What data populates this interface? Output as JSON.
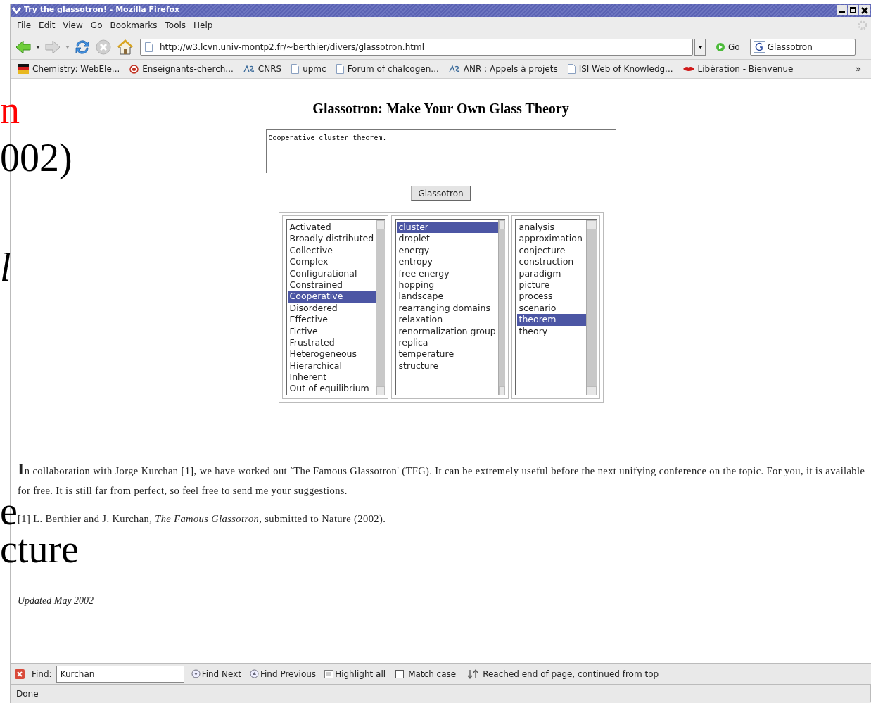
{
  "window": {
    "title": "Try the glassotron! - Mozilla Firefox"
  },
  "menu": [
    {
      "label": "File"
    },
    {
      "label": "Edit"
    },
    {
      "label": "View"
    },
    {
      "label": "Go"
    },
    {
      "label": "Bookmarks"
    },
    {
      "label": "Tools"
    },
    {
      "label": "Help"
    }
  ],
  "toolbar": {
    "url": "http://w3.lcvn.univ-montp2.fr/~berthier/divers/glassotron.html",
    "go": "Go",
    "search": "Glassotron"
  },
  "bookmarks": [
    {
      "label": "Chemistry: WebEle...",
      "kind": "flag"
    },
    {
      "label": "Enseignants-cherch...",
      "kind": "badge"
    },
    {
      "label": "CNRS",
      "kind": "logo"
    },
    {
      "label": "upmc",
      "kind": "page"
    },
    {
      "label": "Forum of chalcogen...",
      "kind": "page"
    },
    {
      "label": "ANR : Appels à projets",
      "kind": "logo"
    },
    {
      "label": "ISI Web of Knowledg...",
      "kind": "page"
    },
    {
      "label": "Libération - Bienvenue",
      "kind": "lips"
    }
  ],
  "bookmarks_overflow": "»",
  "page": {
    "heading": "Glassotron: Make Your Own Glass Theory",
    "output": "Cooperative cluster theorem.",
    "button": "Glassotron",
    "lists": [
      [
        {
          "label": "Activated",
          "selected": false
        },
        {
          "label": "Broadly-distributed",
          "selected": false
        },
        {
          "label": "Collective",
          "selected": false
        },
        {
          "label": "Complex",
          "selected": false
        },
        {
          "label": "Configurational",
          "selected": false
        },
        {
          "label": "Constrained",
          "selected": false
        },
        {
          "label": "Cooperative",
          "selected": true
        },
        {
          "label": "Disordered",
          "selected": false
        },
        {
          "label": "Effective",
          "selected": false
        },
        {
          "label": "Fictive",
          "selected": false
        },
        {
          "label": "Frustrated",
          "selected": false
        },
        {
          "label": "Heterogeneous",
          "selected": false
        },
        {
          "label": "Hierarchical",
          "selected": false
        },
        {
          "label": "Inherent",
          "selected": false
        },
        {
          "label": "Out of equilibrium",
          "selected": false
        }
      ],
      [
        {
          "label": "cluster",
          "selected": true
        },
        {
          "label": "droplet",
          "selected": false
        },
        {
          "label": "energy",
          "selected": false
        },
        {
          "label": "entropy",
          "selected": false
        },
        {
          "label": "free energy",
          "selected": false
        },
        {
          "label": "hopping",
          "selected": false
        },
        {
          "label": "landscape",
          "selected": false
        },
        {
          "label": "rearranging domains",
          "selected": false
        },
        {
          "label": "relaxation",
          "selected": false
        },
        {
          "label": "renormalization group",
          "selected": false
        },
        {
          "label": "replica",
          "selected": false
        },
        {
          "label": "temperature",
          "selected": false
        },
        {
          "label": "structure",
          "selected": false
        }
      ],
      [
        {
          "label": "analysis",
          "selected": false
        },
        {
          "label": "approximation",
          "selected": false
        },
        {
          "label": "conjecture",
          "selected": false
        },
        {
          "label": "construction",
          "selected": false
        },
        {
          "label": "paradigm",
          "selected": false
        },
        {
          "label": "picture",
          "selected": false
        },
        {
          "label": "process",
          "selected": false
        },
        {
          "label": "scenario",
          "selected": false
        },
        {
          "label": "theorem",
          "selected": true
        },
        {
          "label": "theory",
          "selected": false
        }
      ]
    ],
    "paragraph": "**I**n collaboration with Jorge Kurchan [1], we have worked out `The Famous Glassotron' (TFG). It can be extremely useful before the next unifying conference on the topic. For you, it is available for free. It is still far from perfect, so feel free to send me your suggestions.",
    "reference": "[1] L. Berthier and J. Kurchan, *The Famous Glassotron*, submitted to Nature (2002).",
    "updated": "Updated May 2002"
  },
  "find_bar": {
    "label": "Find:",
    "query": "Kurchan",
    "buttons": [
      {
        "label": "Find Next",
        "kind": "down"
      },
      {
        "label": "Find Previous",
        "kind": "up"
      },
      {
        "label": "Highlight all",
        "kind": "highlight"
      }
    ],
    "match_case": {
      "label": "Match case",
      "checked": false
    },
    "message": "Reached end of page, continued from top"
  },
  "status_bar": "Done",
  "slide_fragments": [
    {
      "text": "n",
      "kind": "red"
    },
    {
      "text": "002)",
      "kind": "plain"
    },
    {
      "text": "l",
      "kind": "italic"
    },
    {
      "text": "e",
      "kind": "plain"
    },
    {
      "text": "cture",
      "kind": "plain"
    }
  ]
}
